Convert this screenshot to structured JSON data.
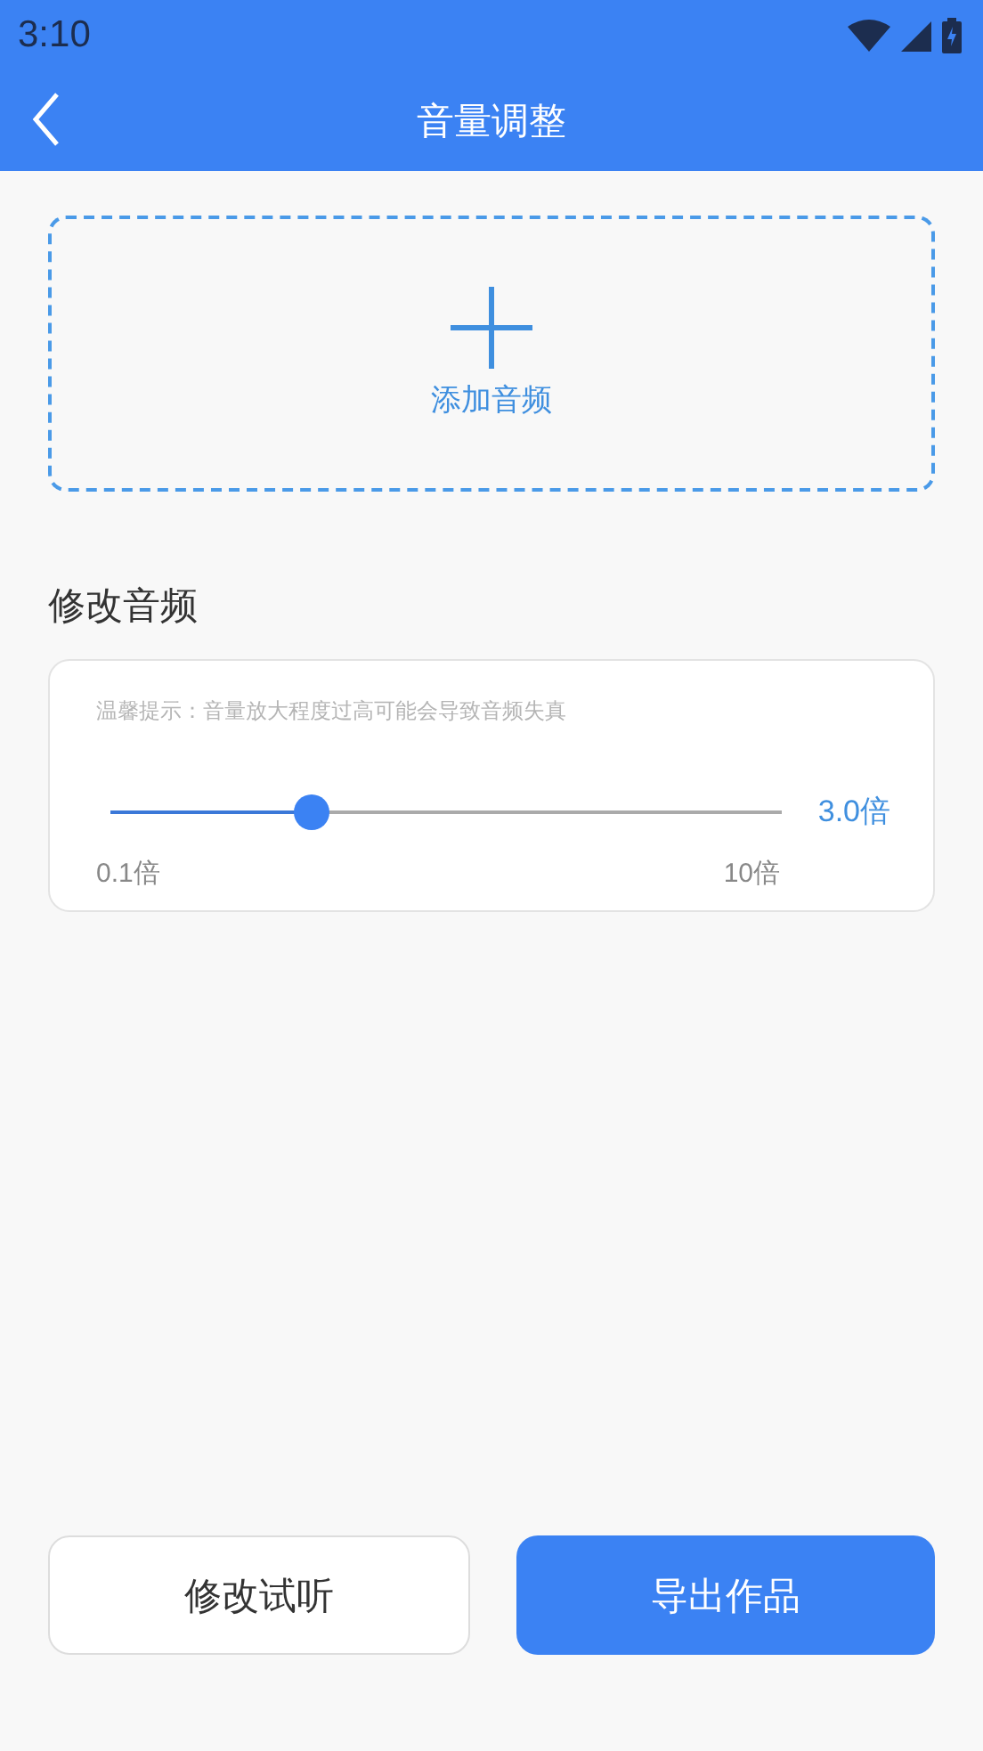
{
  "status_bar": {
    "time": "3:10"
  },
  "header": {
    "title": "音量调整"
  },
  "upload": {
    "label": "添加音频"
  },
  "section": {
    "title": "修改音频"
  },
  "volume": {
    "hint": "温馨提示：音量放大程度过高可能会导致音频失真",
    "level": 0.3,
    "reading": "3.0倍",
    "min_label": "0.1倍",
    "max_label": "10倍"
  },
  "buttons": [
    {
      "label": "修改试听",
      "kind": "secondary"
    },
    {
      "label": "导出作品",
      "kind": "primary"
    }
  ]
}
